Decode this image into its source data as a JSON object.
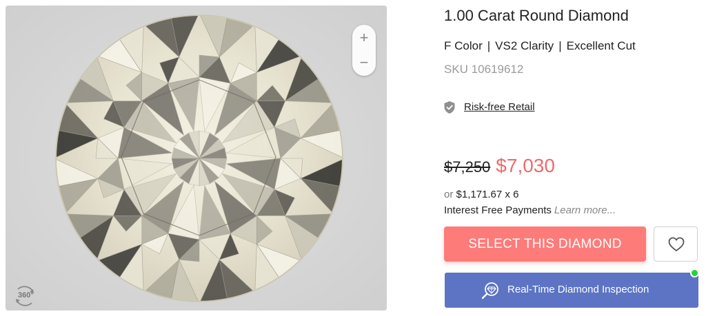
{
  "product": {
    "title": "1.00 Carat Round Diamond",
    "specs": [
      "F Color",
      "VS2 Clarity",
      "Excellent Cut"
    ],
    "sku": "SKU 10619612"
  },
  "viewer": {
    "zoom_in_label": "+",
    "zoom_out_label": "−",
    "view_360_label": "360°",
    "icons": [
      "plus-icon",
      "minus-icon",
      "rotate-360-icon"
    ]
  },
  "guarantee": {
    "icon": "shield-check-icon",
    "label": "Risk-free Retail"
  },
  "pricing": {
    "original_price": "$7,250",
    "sale_price": "$7,030",
    "installment_prefix": "or",
    "installment_amount": "$1,171.67 x 6",
    "interest_label": "Interest Free Payments",
    "learn_more": "Learn more..."
  },
  "actions": {
    "select_label": "SELECT THIS DIAMOND",
    "favorite_icon": "heart-icon",
    "inspection_label": "Real-Time Diamond Inspection",
    "inspection_icon": "diamond-magnifier-icon"
  },
  "colors": {
    "sale_price": "#f06a6a",
    "select_button": "#fd7b79",
    "inspection_button": "#5c74c3",
    "online_indicator": "#26d03e",
    "sku_text": "#9a9a9a"
  }
}
